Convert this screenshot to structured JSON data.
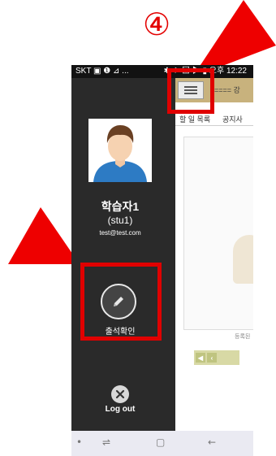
{
  "annotation": {
    "step_number": "④",
    "highlight_color": "#e00000"
  },
  "status_bar": {
    "left_text": "SKT ▣ ❶ ⊿ ...",
    "right_text": "✱ ✈ ⊠ ▶ ▮ 오후 12:22"
  },
  "drawer": {
    "avatar": "avatar-person",
    "user_name": "학습자1",
    "user_id": "(stu1)",
    "user_email": "test@test.com",
    "attendance_label": "출석확인",
    "attendance_icon": "pencil-icon",
    "logout_label": "Log out",
    "logout_icon": "close-icon"
  },
  "content": {
    "title": "==== 강",
    "tabs": [
      "할 일 목록",
      "공지사"
    ],
    "empty_text": "등록된",
    "pager_first": "◀",
    "pager_prev": "‹"
  },
  "navbar": {
    "items": [
      "•",
      "⇌",
      "▢",
      "←"
    ]
  }
}
